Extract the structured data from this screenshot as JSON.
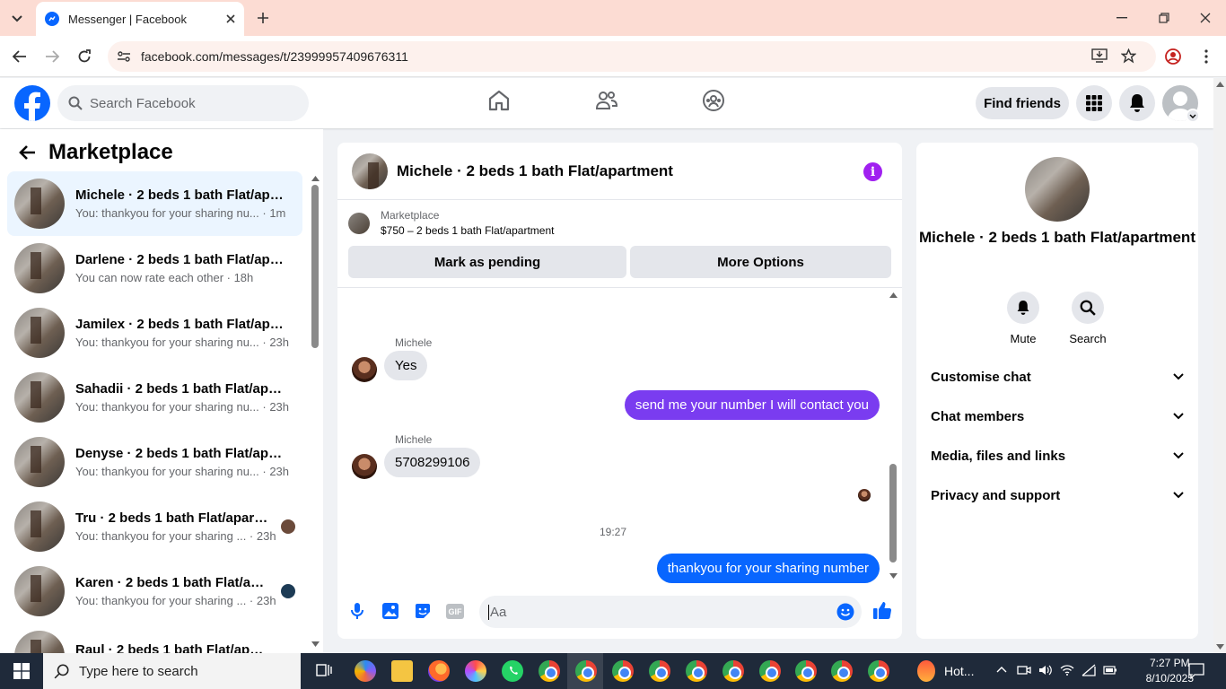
{
  "browser": {
    "tab_title": "Messenger | Facebook",
    "url": "facebook.com/messages/t/23999957409676311"
  },
  "fb_header": {
    "search_placeholder": "Search Facebook",
    "find_friends": "Find friends"
  },
  "sidebar": {
    "title": "Marketplace",
    "conversations": [
      {
        "name": "Michele · 2 beds 1 bath Flat/apa...",
        "preview": "You: thankyou for your sharing nu... · 1m",
        "active": true
      },
      {
        "name": "Darlene · 2 beds 1 bath Flat/apar...",
        "preview": "You can now rate each other · 18h"
      },
      {
        "name": "Jamilex · 2 beds 1 bath Flat/apar...",
        "preview": "You: thankyou for your sharing nu... · 23h"
      },
      {
        "name": "Sahadii · 2 beds 1 bath Flat/apar...",
        "preview": "You: thankyou for your sharing nu... · 23h"
      },
      {
        "name": "Denyse · 2 beds 1 bath Flat/apar...",
        "preview": "You: thankyou for your sharing nu... · 23h"
      },
      {
        "name": "Tru · 2 beds 1 bath Flat/apart...",
        "preview": "You: thankyou for your sharing ... · 23h"
      },
      {
        "name": "Karen · 2 beds 1 bath Flat/apa...",
        "preview": "You: thankyou for your sharing ... · 23h"
      },
      {
        "name": "Raul · 2 beds 1 bath Flat/apart...",
        "preview": ""
      }
    ]
  },
  "chat": {
    "title": "Michele · 2 beds 1 bath Flat/apartment",
    "listing_label": "Marketplace",
    "listing_price": "$750 – 2 beds 1 bath Flat/apartment",
    "mark_pending": "Mark as pending",
    "more_options": "More Options",
    "messages": [
      {
        "sender": "Michele",
        "text": "Yes"
      },
      {
        "text": "send me your number I will contact you"
      },
      {
        "sender": "Michele",
        "text": "5708299106"
      },
      {
        "text": "thankyou for your sharing number"
      }
    ],
    "timestamp": "19:27",
    "composer_placeholder": "Aa",
    "gif_label": "GIF"
  },
  "info_panel": {
    "name": "Michele · 2 beds 1 bath Flat/apartment",
    "mute": "Mute",
    "search": "Search",
    "sections": [
      "Customise chat",
      "Chat members",
      "Media, files and links",
      "Privacy and support"
    ]
  },
  "taskbar": {
    "search_placeholder": "Type here to search",
    "weather": "Hot...",
    "time": "7:27 PM",
    "date": "8/10/2025"
  }
}
